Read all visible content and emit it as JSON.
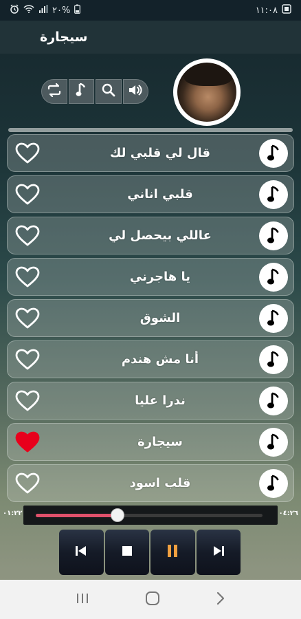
{
  "status": {
    "battery": "٢٠%",
    "time": "١١:٠٨"
  },
  "app": {
    "title": "سيجارة"
  },
  "controls": [
    "repeat-icon",
    "music-note-icon",
    "search-icon",
    "volume-icon"
  ],
  "songs": [
    {
      "title": "قال لي قلبي لك",
      "favorite": false
    },
    {
      "title": "قلبي اناني",
      "favorite": false
    },
    {
      "title": "عاللي بيحصل لي",
      "favorite": false
    },
    {
      "title": "يا هاجرني",
      "favorite": false
    },
    {
      "title": "الشوق",
      "favorite": false
    },
    {
      "title": "أنا مش هندم",
      "favorite": false
    },
    {
      "title": "ندرا عليا",
      "favorite": false
    },
    {
      "title": "سيجارة",
      "favorite": true
    },
    {
      "title": "قلب اسود",
      "favorite": false
    }
  ],
  "player": {
    "elapsed": "٠١:٢٢",
    "duration": "٠٤:٢٦",
    "progress": 0.36
  },
  "colors": {
    "heart_active": "#e8001c",
    "progress_fill": "#e0506a"
  }
}
